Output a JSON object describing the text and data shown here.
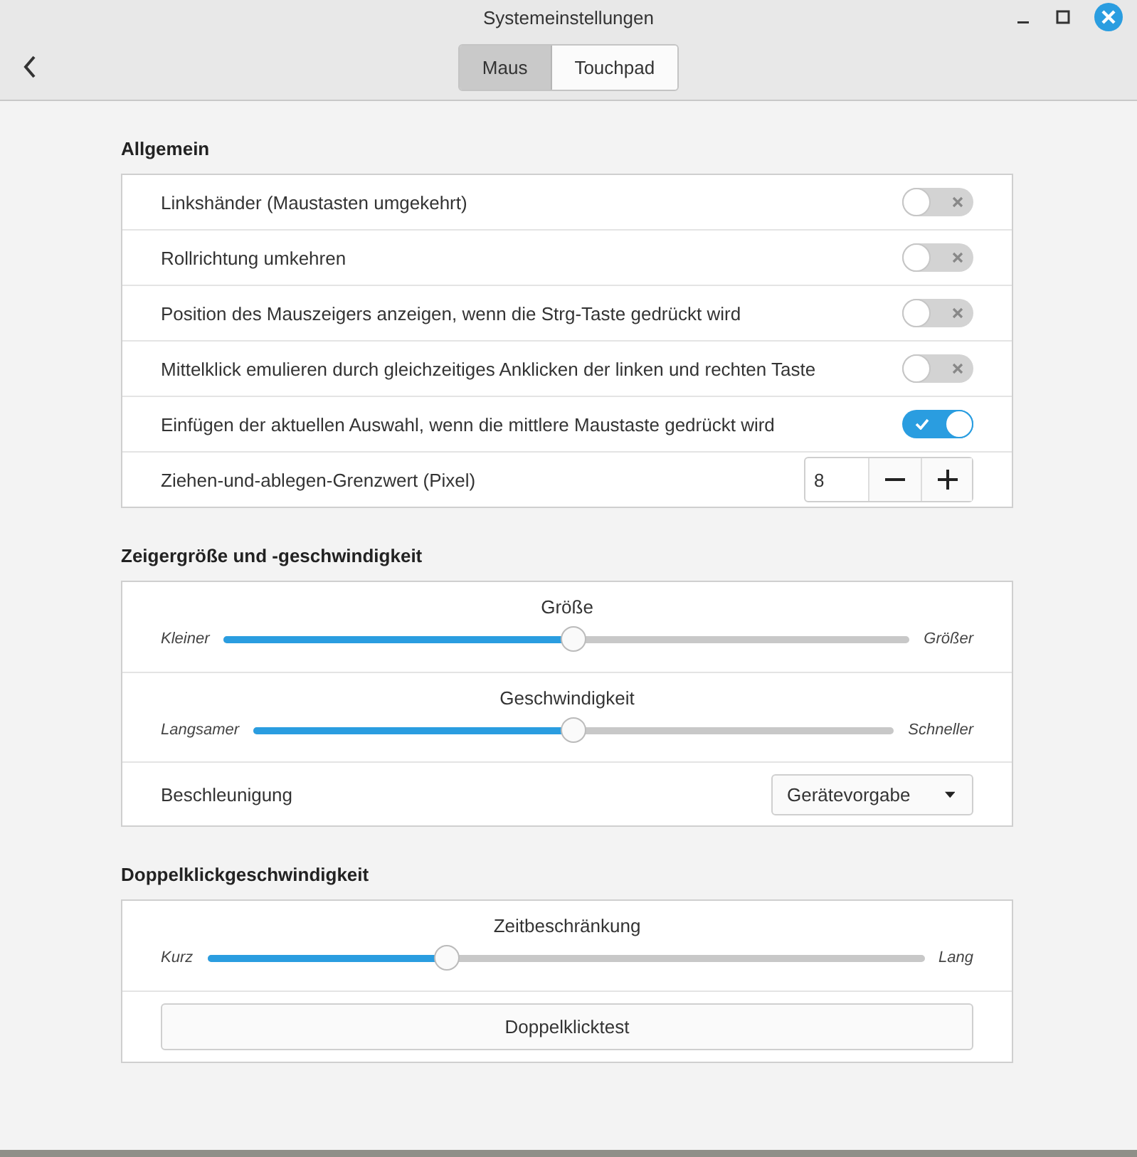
{
  "window": {
    "title": "Systemeinstellungen"
  },
  "tabs": [
    {
      "label": "Maus",
      "selected": true
    },
    {
      "label": "Touchpad",
      "selected": false
    }
  ],
  "sections": [
    {
      "title": "Allgemein",
      "rows": [
        {
          "kind": "switch",
          "label": "Linkshänder (Maustasten umgekehrt)",
          "on": false
        },
        {
          "kind": "switch",
          "label": "Rollrichtung umkehren",
          "on": false
        },
        {
          "kind": "switch",
          "label": "Position des Mauszeigers anzeigen, wenn die Strg-Taste gedrückt wird",
          "on": false
        },
        {
          "kind": "switch",
          "label": "Mittelklick emulieren durch gleichzeitiges Anklicken der linken und rechten Taste",
          "on": false
        },
        {
          "kind": "switch",
          "label": "Einfügen der aktuellen Auswahl, wenn die mittlere Maustaste gedrückt wird",
          "on": true
        },
        {
          "kind": "spin",
          "label": "Ziehen-und-ablegen-Grenzwert (Pixel)",
          "value": "8"
        }
      ]
    },
    {
      "title": "Zeigergröße und -geschwindigkeit",
      "rows": [
        {
          "kind": "slider",
          "label": "Größe",
          "min_label": "Kleiner",
          "max_label": "Größer",
          "level": 0.51
        },
        {
          "kind": "slider",
          "label": "Geschwindigkeit",
          "min_label": "Langsamer",
          "max_label": "Schneller",
          "level": 0.5
        },
        {
          "kind": "dropdown",
          "label": "Beschleunigung",
          "value": "Gerätevorgabe"
        }
      ]
    },
    {
      "title": "Doppelklickgeschwindigkeit",
      "rows": [
        {
          "kind": "slider",
          "label": "Zeitbeschränkung",
          "min_label": "Kurz",
          "max_label": "Lang",
          "level": 0.335
        },
        {
          "kind": "button",
          "label": "Doppelklicktest"
        }
      ]
    }
  ]
}
